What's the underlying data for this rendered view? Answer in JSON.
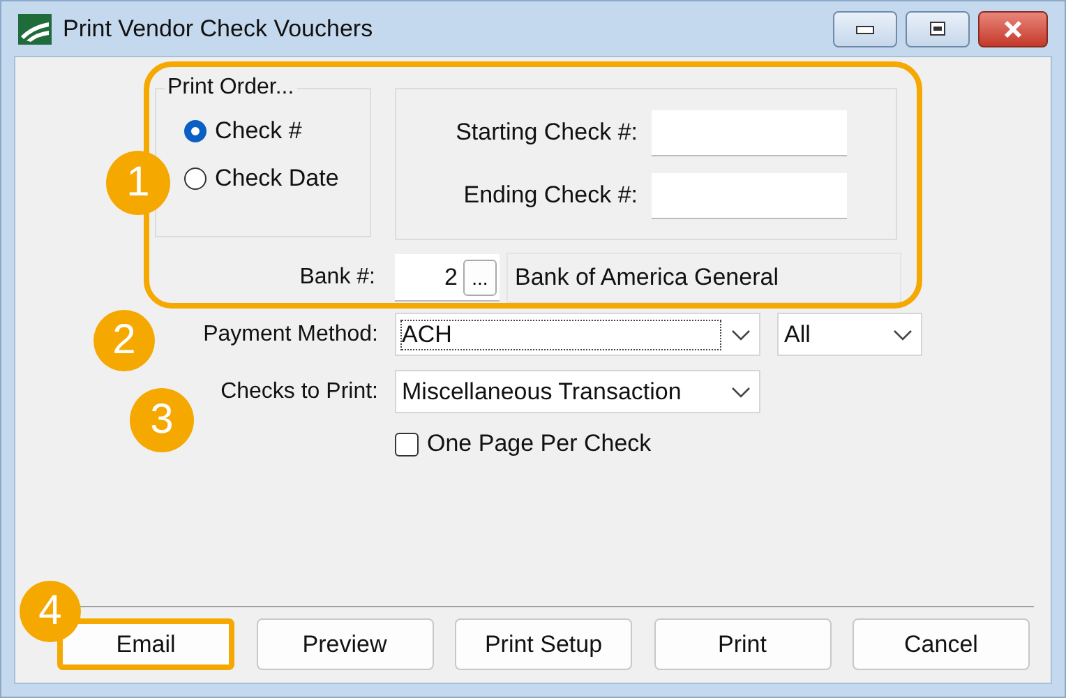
{
  "window": {
    "title": "Print Vendor Check Vouchers"
  },
  "print_order": {
    "title": "Print Order...",
    "options": [
      {
        "label": "Check #",
        "selected": true
      },
      {
        "label": "Check Date",
        "selected": false
      }
    ]
  },
  "check_range": [
    {
      "label": "Starting Check #:"
    },
    {
      "label": "Ending Check #:"
    }
  ],
  "bank": {
    "label": "Bank #:",
    "number": "2",
    "browse": "...",
    "name": "Bank of America General"
  },
  "payment_method": {
    "label": "Payment Method:",
    "value": "ACH",
    "filter": "All"
  },
  "checks_to_print": {
    "label": "Checks to Print:",
    "value": "Miscellaneous Transaction"
  },
  "one_page_per_check": {
    "label": "One Page Per Check",
    "checked": false
  },
  "buttons": [
    {
      "label": "Email",
      "highlighted": true
    },
    {
      "label": "Preview",
      "highlighted": false
    },
    {
      "label": "Print Setup",
      "highlighted": false
    },
    {
      "label": "Print",
      "highlighted": false
    },
    {
      "label": "Cancel",
      "highlighted": false
    }
  ],
  "callouts": [
    "1",
    "2",
    "3",
    "4"
  ]
}
